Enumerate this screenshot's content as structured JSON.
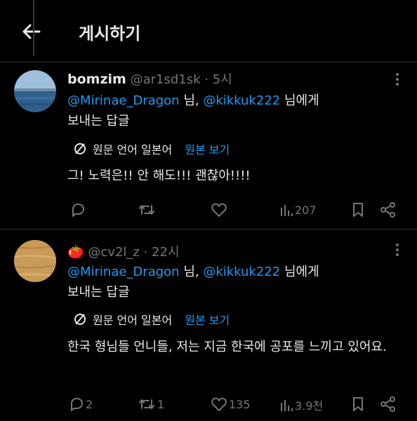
{
  "header": {
    "title": "게시하기"
  },
  "posts": [
    {
      "name": "bomzim",
      "handle": "@ar1sd1sk",
      "time": "· 5시",
      "reply_mentions": [
        "@Mirinae_Dragon",
        "@kikkuk222"
      ],
      "reply_sep": " 님, ",
      "reply_tail": " 님에게",
      "reply_line2": "보내는 답글",
      "translate_note": "원문 언어 일본어",
      "translate_link": "원본 보기",
      "text": "그! 노력은!! 안 해도!!! 괜찮아!!!!",
      "stats": {
        "replies": "",
        "reposts": "",
        "likes": "",
        "views": "207"
      }
    },
    {
      "name": "🍅",
      "handle": "@cv2l_z",
      "time": "· 22시",
      "reply_mentions": [
        "@Mirinae_Dragon",
        "@kikkuk222"
      ],
      "reply_sep": " 님, ",
      "reply_tail": " 님에게",
      "reply_line2": "보내는 답글",
      "translate_note": "원문 언어 일본어",
      "translate_link": "원본 보기",
      "text": "한국 형님들 언니들, 저는 지금 한국에 공포를 느끼고 있어요.",
      "stats": {
        "replies": "2",
        "reposts": "1",
        "likes": "135",
        "views": "3.9천"
      }
    }
  ],
  "colors": {
    "background": "#000000",
    "accent": "#1d9bf0",
    "muted": "#71767b",
    "text": "#e7e9ea"
  }
}
